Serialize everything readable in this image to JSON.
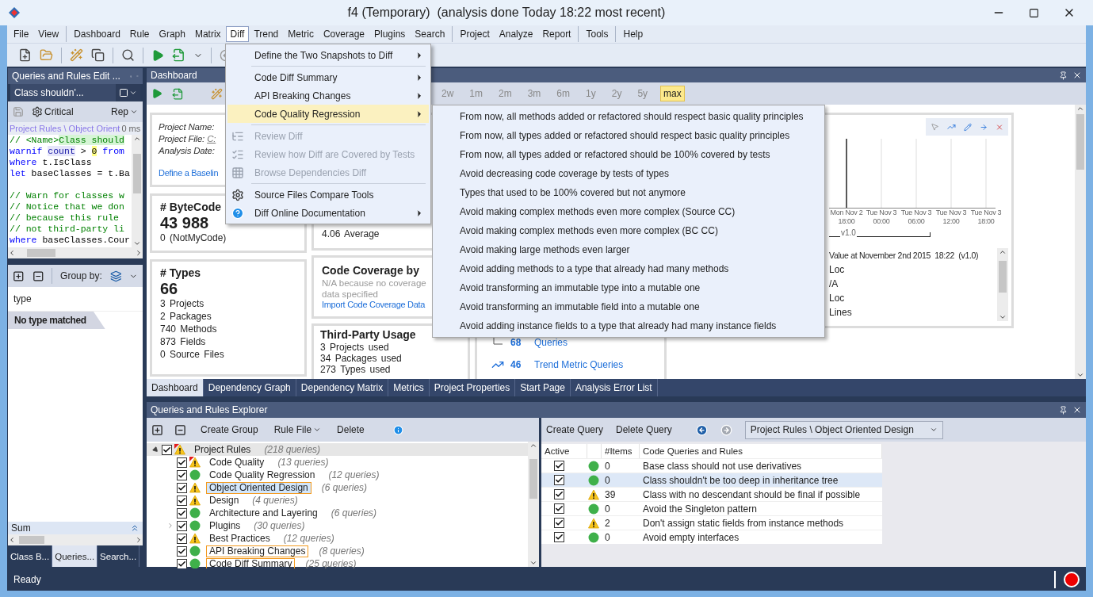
{
  "window": {
    "title": "f4 (Temporary)  (analysis done Today 18:22 most recent)"
  },
  "menu_bar": [
    {
      "items": [
        {
          "label": "File",
          "selected": false
        },
        {
          "label": "View",
          "selected": false
        }
      ]
    },
    {
      "items": [
        {
          "label": "Dashboard",
          "selected": false
        },
        {
          "label": "Rule",
          "selected": false
        },
        {
          "label": "Graph",
          "selected": false
        },
        {
          "label": "Matrix",
          "selected": false
        },
        {
          "label": "Diff",
          "selected": true
        },
        {
          "label": "Trend",
          "selected": false
        },
        {
          "label": "Metric",
          "selected": false
        },
        {
          "label": "Coverage",
          "selected": false
        },
        {
          "label": "Plugins",
          "selected": false
        },
        {
          "label": "Search",
          "selected": false
        }
      ]
    },
    {
      "items": [
        {
          "label": "Project",
          "selected": false
        },
        {
          "label": "Analyze",
          "selected": false
        },
        {
          "label": "Report",
          "selected": false
        }
      ]
    },
    {
      "items": [
        {
          "label": "Tools",
          "selected": false
        }
      ]
    },
    {
      "items": [
        {
          "label": "Help",
          "selected": false
        }
      ]
    }
  ],
  "diff_menu": {
    "groups": [
      [
        {
          "label": "Define the Two Snapshots to Diff",
          "submenu": true,
          "disabled": false,
          "selected": false
        }
      ],
      [
        {
          "label": "Code Diff Summary",
          "submenu": true,
          "disabled": false,
          "selected": false
        },
        {
          "label": "API Breaking Changes",
          "submenu": true,
          "disabled": false,
          "selected": false
        },
        {
          "label": "Code Quality Regression",
          "submenu": true,
          "disabled": false,
          "selected": true
        }
      ],
      [
        {
          "label": "Review Diff",
          "submenu": false,
          "disabled": true,
          "selected": false
        },
        {
          "label": "Review how Diff are Covered by Tests",
          "submenu": false,
          "disabled": true,
          "selected": false
        },
        {
          "label": "Browse Dependencies Diff",
          "submenu": false,
          "disabled": true,
          "selected": false
        }
      ],
      [
        {
          "label": "Source Files Compare Tools",
          "submenu": false,
          "disabled": false,
          "selected": false
        },
        {
          "label": "Diff Online Documentation",
          "submenu": true,
          "disabled": false,
          "selected": false
        }
      ]
    ]
  },
  "regression_submenu": {
    "items": [
      "From now, all methods added or refactored should respect basic quality principles",
      "From now, all types added or refactored should respect basic quality principles",
      "From now, all types added or refactored should be 100% covered by tests",
      "Avoid decreasing code coverage by tests of types",
      "Types that used to be 100% covered but not anymore",
      "Avoid making complex methods even more complex (Source CC)",
      "Avoid making complex methods even more complex (BC CC)",
      "Avoid making large methods even larger",
      "Avoid adding methods to a type that already had many methods",
      "Avoid transforming an immutable type into a mutable one",
      "Avoid transforming an immutable field into a mutable one",
      "Avoid adding instance fields to a type that already had many instance fields"
    ]
  },
  "rules_editor": {
    "title": "Queries and Rules Edit ...",
    "query_name": "Class shouldn'...",
    "severity": "Critical",
    "report_menu": "Rep",
    "path": "Project Rules \\ Object Orient",
    "duration": "0 ms",
    "code_lines": [
      {
        "kind": "code",
        "segments": [
          {
            "text": "// <Name>",
            "kind": "comment"
          },
          {
            "text": "Class should",
            "kind": "match"
          }
        ]
      },
      {
        "kind": "code",
        "segments": [
          {
            "text": "warnif ",
            "kind": "keyword"
          },
          {
            "text": "count",
            "kind": "symbol"
          },
          {
            "text": " > ",
            "kind": "plain"
          },
          {
            "text": "0",
            "kind": "number"
          },
          {
            "text": " from",
            "kind": "keyword"
          }
        ]
      },
      {
        "kind": "code",
        "segments": [
          {
            "text": "where",
            "kind": "keyword"
          },
          {
            "text": " t.IsClass",
            "kind": "plain"
          }
        ]
      },
      {
        "kind": "code",
        "segments": [
          {
            "text": "let",
            "kind": "keyword"
          },
          {
            "text": " baseClasses = t.Ba",
            "kind": "plain"
          }
        ]
      },
      {
        "kind": "blank"
      },
      {
        "kind": "code",
        "segments": [
          {
            "text": "// Warn for classes w",
            "kind": "comment"
          }
        ]
      },
      {
        "kind": "code",
        "segments": [
          {
            "text": "// Notice that we don",
            "kind": "comment"
          }
        ]
      },
      {
        "kind": "code",
        "segments": [
          {
            "text": "// because this rule",
            "kind": "comment"
          }
        ]
      },
      {
        "kind": "code",
        "segments": [
          {
            "text": "// not third-party li",
            "kind": "comment"
          }
        ]
      },
      {
        "kind": "code",
        "segments": [
          {
            "text": "where",
            "kind": "keyword"
          },
          {
            "text": " baseClasses.Cour",
            "kind": "plain"
          }
        ]
      }
    ]
  },
  "result_panel": {
    "group_by_label": "Group by:",
    "column": "type",
    "empty_message": "No type matched",
    "sum_label": "Sum"
  },
  "left_tabs": [
    {
      "label": "Class B...",
      "selected": false
    },
    {
      "label": "Queries...",
      "selected": true
    },
    {
      "label": "Search...",
      "selected": false
    }
  ],
  "dashboard": {
    "title": "Dashboard",
    "ranges": [
      {
        "label": "2w",
        "selected": false
      },
      {
        "label": "1m",
        "selected": false
      },
      {
        "label": "2m",
        "selected": false
      },
      {
        "label": "3m",
        "selected": false
      },
      {
        "label": "6m",
        "selected": false
      },
      {
        "label": "1y",
        "selected": false
      },
      {
        "label": "2y",
        "selected": false
      },
      {
        "label": "5y",
        "selected": false
      },
      {
        "label": "max",
        "selected": true
      }
    ],
    "project_info": {
      "name_label": "Project Name:",
      "file_label": "Project File:",
      "file_value": "C:",
      "date_label": "Analysis Date:",
      "baseline_link": "Define a Baselin"
    },
    "bytecode": {
      "title": "# ByteCode",
      "value": "43 988",
      "rows": [
        "0 (NotMyCode)"
      ]
    },
    "types": {
      "title": "# Types",
      "value": "66",
      "rows": [
        "3 Projects",
        "2 Packages",
        "740 Methods",
        "873 Fields",
        "0 Source Files"
      ]
    },
    "complexity": {
      "rows": [
        "4.06 Average"
      ]
    },
    "coverage": {
      "title": "Code Coverage by",
      "note": "N/A because no coverage data specified",
      "link": "Import Code Coverage Data"
    },
    "third_party": {
      "title": "Third-Party Usage",
      "rows": [
        "3 Projects used",
        "34 Packages used",
        "273 Types used"
      ]
    },
    "rules_summary": {
      "rows": [
        {
          "value": "68",
          "label": "Queries"
        },
        {
          "value": "46",
          "label": "Trend Metric Queries"
        }
      ]
    },
    "trend_chart": {
      "x_labels": [
        {
          "date": "Mon Nov 2",
          "time": "18:00"
        },
        {
          "date": "Tue Nov 3",
          "time": "00:00"
        },
        {
          "date": "Tue Nov 3",
          "time": "06:00"
        },
        {
          "date": "Tue Nov 3",
          "time": "12:00"
        },
        {
          "date": "Tue Nov 3",
          "time": "18:00"
        }
      ],
      "version": "v1.0",
      "value_header": "Value at November 2nd 2015  18:22  (v1.0)",
      "values": [
        "Loc",
        "/A",
        "Loc",
        "Lines"
      ]
    }
  },
  "document_tabs": [
    {
      "label": "Dashboard",
      "selected": true
    },
    {
      "label": "Dependency Graph",
      "selected": false
    },
    {
      "label": "Dependency Matrix",
      "selected": false
    },
    {
      "label": "Metrics",
      "selected": false
    },
    {
      "label": "Project Properties",
      "selected": false
    },
    {
      "label": "Start Page",
      "selected": false
    },
    {
      "label": "Analysis Error List",
      "selected": false
    }
  ],
  "explorer": {
    "title": "Queries and Rules Explorer",
    "toolbar": [
      {
        "label": "Create Group",
        "dropdown": false
      },
      {
        "label": "Rule File",
        "dropdown": true
      },
      {
        "label": "Delete",
        "dropdown": false
      }
    ],
    "tree": [
      {
        "label": "Project Rules",
        "count": "(218 queries)",
        "checked": true,
        "warning": true,
        "critical": true,
        "expanded": true,
        "hovered": true,
        "selected": false,
        "outlined": false,
        "children": [
          {
            "label": "Code Quality",
            "count": "(13 queries)",
            "checked": true,
            "warning": true,
            "critical": true,
            "hovered": false,
            "selected": false,
            "outlined": false
          },
          {
            "label": "Code Quality Regression",
            "count": "(12 queries)",
            "checked": true,
            "warning": false,
            "critical": false,
            "hovered": false,
            "selected": false,
            "outlined": false
          },
          {
            "label": "Object Oriented Design",
            "count": "(6 queries)",
            "checked": true,
            "warning": true,
            "critical": false,
            "hovered": false,
            "selected": true,
            "outlined": true
          },
          {
            "label": "Design",
            "count": "(4 queries)",
            "checked": true,
            "warning": true,
            "critical": false,
            "hovered": false,
            "selected": false,
            "outlined": false
          },
          {
            "label": "Architecture and Layering",
            "count": "(6 queries)",
            "checked": true,
            "warning": false,
            "critical": false,
            "hovered": false,
            "selected": false,
            "outlined": false
          },
          {
            "label": "Plugins",
            "count": "(30 queries)",
            "checked": true,
            "warning": false,
            "critical": false,
            "expanded": false,
            "hovered": false,
            "selected": false,
            "outlined": false
          },
          {
            "label": "Best Practices",
            "count": "(12 queries)",
            "checked": true,
            "warning": true,
            "critical": false,
            "hovered": false,
            "selected": false,
            "outlined": false
          },
          {
            "label": "API Breaking Changes",
            "count": "(8 queries)",
            "checked": true,
            "warning": false,
            "critical": false,
            "hovered": false,
            "selected": false,
            "outlined": true
          },
          {
            "label": "Code Diff Summary",
            "count": "(25 queries)",
            "checked": true,
            "warning": false,
            "critical": false,
            "hovered": false,
            "selected": false,
            "outlined": true
          }
        ]
      }
    ],
    "grid": {
      "toolbar": [
        "Create Query",
        "Delete Query"
      ],
      "path": "Project Rules \\ Object Oriented Design",
      "columns": [
        "Active",
        "#Items",
        "Code Queries and Rules"
      ],
      "rows": [
        {
          "checked": true,
          "warning": false,
          "items": "0",
          "name": "Base class should not use derivatives",
          "selected": false
        },
        {
          "checked": true,
          "warning": false,
          "items": "0",
          "name": "Class shouldn't be too deep in inheritance tree",
          "selected": true
        },
        {
          "checked": true,
          "warning": true,
          "items": "39",
          "name": "Class with no descendant should be final if possible",
          "selected": false
        },
        {
          "checked": true,
          "warning": false,
          "items": "0",
          "name": "Avoid the Singleton pattern",
          "selected": false
        },
        {
          "checked": true,
          "warning": true,
          "items": "2",
          "name": "Don't assign static fields from instance methods",
          "selected": false
        },
        {
          "checked": true,
          "warning": false,
          "items": "0",
          "name": "Avoid empty interfaces",
          "selected": false
        }
      ]
    }
  },
  "status_bar": {
    "text": "Ready"
  }
}
